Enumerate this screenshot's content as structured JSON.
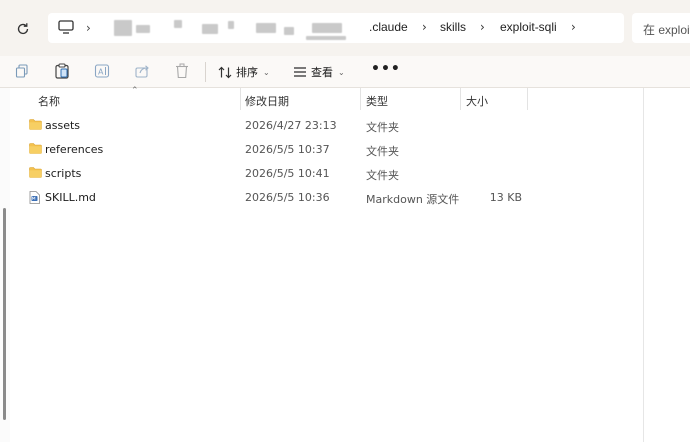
{
  "address_bar": {
    "breadcrumbs": [
      ".claude",
      "skills",
      "exploit-sqli"
    ],
    "search_placeholder": "在 exploit-sqli 中搜索"
  },
  "toolbar": {
    "sort_label": "排序",
    "view_label": "查看",
    "more_label": "•••"
  },
  "columns": {
    "name": "名称",
    "modified": "修改日期",
    "type": "类型",
    "size": "大小"
  },
  "files": [
    {
      "name": "assets",
      "modified": "2026/4/27 23:13",
      "type": "文件夹",
      "size": "",
      "icon": "folder-icon"
    },
    {
      "name": "references",
      "modified": "2026/5/5 10:37",
      "type": "文件夹",
      "size": "",
      "icon": "folder-icon"
    },
    {
      "name": "scripts",
      "modified": "2026/5/5 10:41",
      "type": "文件夹",
      "size": "",
      "icon": "folder-icon"
    },
    {
      "name": "SKILL.md",
      "modified": "2026/5/5 10:36",
      "type": "Markdown 源文件",
      "size": "13 KB",
      "icon": "markdown-file-icon"
    }
  ],
  "colors": {
    "folder": "#f4c24f",
    "addr_bg": "#f6f3ef",
    "toolbar_bg": "#fbf9f7"
  }
}
